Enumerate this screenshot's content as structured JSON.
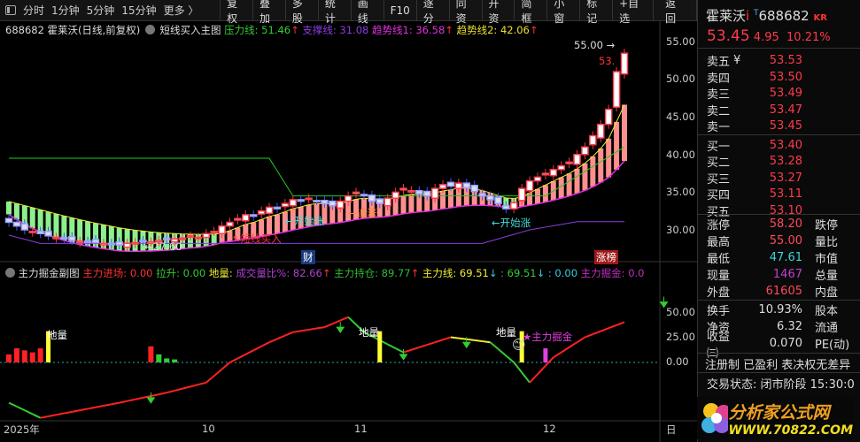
{
  "toolbar": {
    "periods": [
      "分时",
      "1分钟",
      "5分钟",
      "15分钟",
      "更多 〉"
    ],
    "buttons": [
      "复权",
      "叠加",
      "多股",
      "统计",
      "画线",
      "F10",
      "逐分",
      "同资",
      "开资",
      "简框",
      "小窗",
      "标记",
      "+自选",
      "返回"
    ]
  },
  "main_title": {
    "code_name": "688682 霍莱沃(日线,前复权)",
    "indicator": "短线买入主图",
    "pressure": "压力线: 51.46",
    "support": "支撑线: 31.08",
    "trend1": "趋势线1: 36.58",
    "trend2": "趋势线2: 42.06",
    "arrow_up": "↑",
    "arrow_down": "↓"
  },
  "sub_title": {
    "name": "主力掘金副图",
    "entry": "主力进场: 0.00",
    "pull": "拉升: 0.00",
    "low_vol": "地量:",
    "vol_ratio": "成交量比%: 82.66",
    "hold": "主力持仓: 89.77",
    "main_line": "主力线: 69.51",
    "v2": ": 69.51",
    "v3": ": 0.00",
    "dig": "主力掘金: 0.0"
  },
  "annotations": {
    "high": "55.00",
    "high_arrow": "→",
    "low": "←27.60",
    "short_buy": "↖短线买入",
    "start1": "←开始涨",
    "chase": "←追涨",
    "start2": "←开始涨",
    "cai": "财",
    "zhangbang": "涨榜",
    "price_tag": "53.",
    "diliang": "地量",
    "dig_star": "★主力掘金"
  },
  "y_main": [
    "55.00",
    "50.00",
    "45.00",
    "40.00",
    "35.00",
    "30.00"
  ],
  "y_sub": [
    "50.00",
    "25.00",
    "0.00"
  ],
  "x_axis": [
    "2025年",
    "10",
    "11",
    "12",
    "日"
  ],
  "quote": {
    "name": "霍莱沃",
    "i": "i",
    "t": "T",
    "code": "688682",
    "kr": "KR",
    "price": "53.45",
    "change": "4.95",
    "pct": "10.21%"
  },
  "order_book": [
    {
      "label": "卖五",
      "extra": "¥",
      "price": "53.53"
    },
    {
      "label": "卖四",
      "price": "53.50"
    },
    {
      "label": "卖三",
      "price": "53.49"
    },
    {
      "label": "卖二",
      "price": "53.47"
    },
    {
      "label": "卖一",
      "price": "53.45"
    },
    {
      "label": "买一",
      "price": "53.40"
    },
    {
      "label": "买二",
      "price": "53.28"
    },
    {
      "label": "买三",
      "price": "53.27"
    },
    {
      "label": "买四",
      "price": "53.11"
    },
    {
      "label": "买五",
      "price": "53.10"
    }
  ],
  "stats": [
    {
      "l": "涨停",
      "v": "58.20",
      "c": "#ff4a5a",
      "r": "跌停"
    },
    {
      "l": "最高",
      "v": "55.00",
      "c": "#ff4a5a",
      "r": "量比"
    },
    {
      "l": "最低",
      "v": "47.61",
      "c": "#3cd6e0",
      "r": "市值"
    },
    {
      "l": "现量",
      "v": "1467",
      "c": "#c040d0",
      "r": "总量"
    },
    {
      "l": "外盘",
      "v": "61605",
      "c": "#ff4a5a",
      "r": "内盘"
    }
  ],
  "stats2": [
    {
      "l": "换手",
      "v": "10.93%",
      "r": "股本"
    },
    {
      "l": "净资",
      "v": "6.32",
      "r": "流通"
    },
    {
      "l": "收益㈢",
      "v": "0.070",
      "r": "PE(动)"
    }
  ],
  "tags": "注册制 已盈利 表决权无差异",
  "trade_status": "交易状态: 闭市阶段 15:30:0",
  "logo": {
    "cn": "分析家公式网",
    "url": "WWW.70822.COM"
  },
  "chart_data": {
    "type": "candlestick",
    "closes": [
      31,
      30.5,
      30,
      29.8,
      29.5,
      29.2,
      29,
      28.8,
      28.6,
      28.5,
      28.4,
      28.3,
      28.2,
      28.1,
      28.0,
      28.2,
      28.3,
      28.5,
      28.4,
      28.6,
      28.7,
      28.8,
      28.9,
      29.2,
      29.0,
      29.5,
      29.8,
      30.5,
      31,
      31.5,
      32,
      31.8,
      32.5,
      33,
      32.8,
      33.5,
      34,
      33.8,
      34.2,
      33.9,
      33.5,
      33.2,
      33.8,
      34.5,
      35,
      34.6,
      33.8,
      33.5,
      34.2,
      35,
      35.5,
      35.2,
      34.8,
      34.5,
      35.5,
      36,
      35.8,
      36.2,
      35.6,
      35.1,
      34.5,
      34,
      33.5,
      32.8,
      33.6,
      35.5,
      36.5,
      37,
      37.5,
      38,
      38.5,
      39,
      40,
      41,
      42.5,
      44,
      46,
      51,
      53.45
    ],
    "pressure_keys": [
      [
        0,
        39.5
      ],
      [
        33,
        39.5
      ],
      [
        36,
        34.5
      ],
      [
        68,
        34.5
      ],
      [
        78,
        41
      ],
      [
        84,
        51.46
      ]
    ],
    "support_keys": [
      [
        0,
        29.3
      ],
      [
        4,
        28.2
      ],
      [
        60,
        28.2
      ],
      [
        66,
        30
      ],
      [
        72,
        31.08
      ],
      [
        84,
        31.08
      ]
    ],
    "sub_keys": [
      [
        0,
        -40
      ],
      [
        4,
        -55
      ],
      [
        14,
        -40
      ],
      [
        20,
        -30
      ],
      [
        25,
        -20
      ],
      [
        28,
        0
      ],
      [
        33,
        20
      ],
      [
        36,
        30
      ],
      [
        40,
        35
      ],
      [
        43,
        45
      ],
      [
        45,
        30
      ],
      [
        50,
        10
      ],
      [
        56,
        25
      ],
      [
        61,
        20
      ],
      [
        64,
        0
      ],
      [
        66,
        -20
      ],
      [
        69,
        5
      ],
      [
        73,
        25
      ],
      [
        78,
        40
      ],
      [
        81,
        55
      ],
      [
        83,
        75
      ],
      [
        85,
        65
      ]
    ],
    "ylim": [
      26,
      57
    ],
    "sub_ylim": [
      -60,
      85
    ]
  }
}
